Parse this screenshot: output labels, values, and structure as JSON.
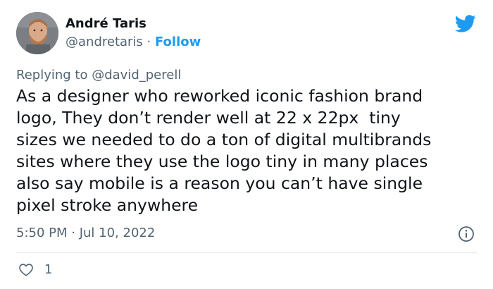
{
  "author": {
    "display_name": "André Taris",
    "handle": "@andretaris",
    "separator": " · ",
    "follow_label": "Follow"
  },
  "reply": {
    "prefix": "Replying to ",
    "mention": "@david_perell"
  },
  "tweet": {
    "lines": [
      "As a designer who reworked iconic fashion brand",
      "logo, They don’t render well at 22 x 22px  tiny",
      "sizes we needed to do a ton of digital multibrands",
      "sites where they use the logo tiny in many places",
      "also say mobile is a reason you can’t have single",
      "pixel stroke anywhere"
    ]
  },
  "meta": {
    "time": "5:50 PM",
    "separator": " · ",
    "date": "Jul 10, 2022"
  },
  "engagement": {
    "like_count": "1"
  },
  "icons": {
    "brand": "twitter-bird-icon",
    "info": "info-icon",
    "like": "heart-icon"
  },
  "colors": {
    "accent": "#1d9bf0",
    "text_primary": "#0f1419",
    "text_secondary": "#536471",
    "divider": "#e7ebee"
  }
}
